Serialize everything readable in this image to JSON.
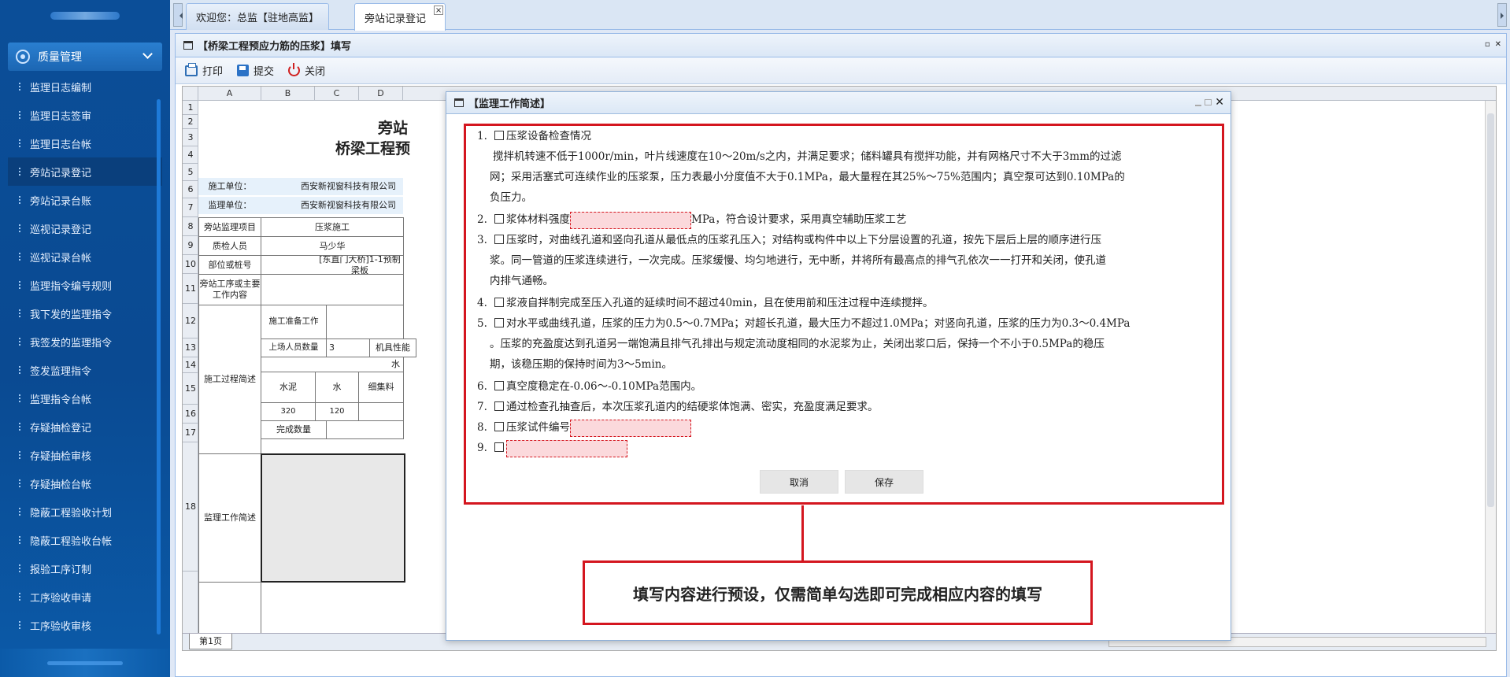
{
  "sidebar": {
    "menu_title": "质量管理",
    "items": [
      {
        "label": "监理日志编制"
      },
      {
        "label": "监理日志签审"
      },
      {
        "label": "监理日志台帐"
      },
      {
        "label": "旁站记录登记"
      },
      {
        "label": "旁站记录台账"
      },
      {
        "label": "巡视记录登记"
      },
      {
        "label": "巡视记录台帐"
      },
      {
        "label": "监理指令编号规则"
      },
      {
        "label": "我下发的监理指令"
      },
      {
        "label": "我签发的监理指令"
      },
      {
        "label": "签发监理指令"
      },
      {
        "label": "监理指令台帐"
      },
      {
        "label": "存疑抽检登记"
      },
      {
        "label": "存疑抽检审核"
      },
      {
        "label": "存疑抽检台帐"
      },
      {
        "label": "隐蔽工程验收计划"
      },
      {
        "label": "隐蔽工程验收台帐"
      },
      {
        "label": "报验工序订制"
      },
      {
        "label": "工序验收申请"
      },
      {
        "label": "工序验收审核"
      }
    ],
    "active_index": 3
  },
  "tabs": [
    {
      "label": "欢迎您：总监【驻地高监】"
    },
    {
      "label": "旁站记录登记"
    }
  ],
  "panel": {
    "title": "【桥梁工程预应力筋的压浆】填写",
    "toolbar": {
      "print": "打印",
      "submit": "提交",
      "close": "关闭"
    }
  },
  "sheet": {
    "columns": [
      "A",
      "B",
      "C",
      "D"
    ],
    "rows": [
      "1",
      "2",
      "3",
      "4",
      "5",
      "6",
      "7",
      "8",
      "9",
      "10",
      "11",
      "12",
      "13",
      "14",
      "15",
      "16",
      "17",
      "18"
    ],
    "title_row2": "旁站",
    "title_row3": "桥梁工程预",
    "construction_unit_label": "施工单位：",
    "construction_unit_value": "西安新视窗科技有限公司",
    "supervision_unit_label": "监理单位：",
    "supervision_unit_value": "西安新视窗科技有限公司",
    "project_label": "旁站监理项目",
    "project_value": "压浆施工",
    "inspector_label": "质检人员",
    "inspector_value": "马少华",
    "location_label": "部位或桩号",
    "location_value": "[东直门大桥]1-1预制梁板",
    "process_label": "旁站工序或主要工作内容",
    "process_summary_label": "施工过程简述",
    "prep_work_label": "施工准备工作",
    "staff_count_label": "上场人员数量",
    "staff_count_value": "3",
    "machine_label": "机具性能",
    "row13_partial": "水",
    "cement_label": "水泥",
    "water_label": "水",
    "aggregate_label": "细集料",
    "cement_value": "320",
    "water_value": "120",
    "finished_qty_label": "完成数量",
    "supervision_summary_label": "监理工作简述",
    "sheet_tab": "第1页"
  },
  "dialog": {
    "title": "【监理工作简述】",
    "items": [
      {
        "num": "1.",
        "text": "压浆设备检查情况"
      },
      {
        "num": "2.",
        "text_before": "浆体材料强度",
        "text_after": "MPa，符合设计要求，采用真空辅助压浆工艺"
      },
      {
        "num": "3.",
        "text": "压浆时，对曲线孔道和竖向孔道从最低点的压浆孔压入；对结构或构件中以上下分层设置的孔道，按先下层后上层的顺序进行压"
      },
      {
        "num": "4.",
        "text": "浆液自拌制完成至压入孔道的延续时间不超过40min，且在使用前和压注过程中连续搅拌。"
      },
      {
        "num": "5.",
        "text": "对水平或曲线孔道，压浆的压力为0.5～0.7MPa；对超长孔道，最大压力不超过1.0MPa；对竖向孔道，压浆的压力为0.3～0.4MPa"
      },
      {
        "num": "6.",
        "text": "真空度稳定在-0.06～-0.10MPa范围内。"
      },
      {
        "num": "7.",
        "text": "通过检查孔抽查后，本次压浆孔道内的结硬浆体饱满、密实，充盈度满足要求。"
      },
      {
        "num": "8.",
        "text": "压浆试件编号"
      },
      {
        "num": "9.",
        "text": ""
      }
    ],
    "item1_para": [
      "搅拌机转速不低于1000r/min，叶片线速度在10～20m/s之内，并满足要求；储料罐具有搅拌功能，并有网格尺寸不大于3mm的过滤",
      "网；采用活塞式可连续作业的压浆泵，压力表最小分度值不大于0.1MPa，最大量程在其25%～75%范围内；真空泵可达到0.10MPa的",
      "负压力。"
    ],
    "item3_para": [
      "浆。同一管道的压浆连续进行，一次完成。压浆缓慢、均匀地进行，无中断，并将所有最高点的排气孔依次一一打开和关闭，使孔道",
      "内排气通畅。"
    ],
    "item5_para": [
      "。压浆的充盈度达到孔道另一端饱满且排气孔排出与规定流动度相同的水泥浆为止，关闭出浆口后，保持一个不小于0.5MPa的稳压",
      "期，该稳压期的保持时间为3～5min。"
    ],
    "cancel": "取消",
    "save": "保存"
  },
  "callout": "填写内容进行预设，仅需简单勾选即可完成相应内容的填写",
  "colors": {
    "highlight_red": "#d4161f",
    "sidebar_blue": "#0b4e98",
    "input_fill": "#fbd9dc"
  }
}
